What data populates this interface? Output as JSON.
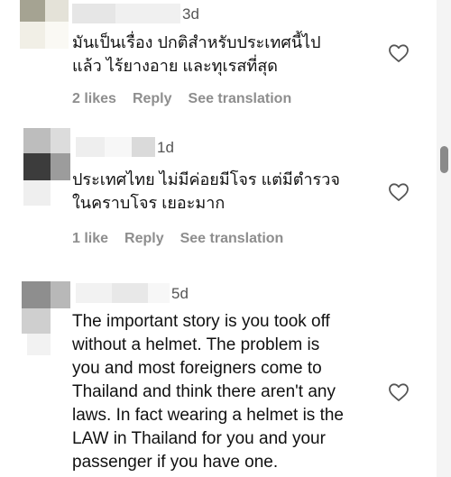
{
  "comments": [
    {
      "time": "3d",
      "text_lines": [
        "มันเป็นเรื่อง ปกติสำหรับประเทศนี้ไป",
        "แล้ว ไร้ยางอาย และทุเรสที่สุด"
      ],
      "likes": "2 likes",
      "reply": "Reply",
      "translate": "See translation"
    },
    {
      "time": "1d",
      "text_lines": [
        "ประเทศไทย ไม่มีค่อยมีโจร แต่มีตำรวจ",
        "ในคราบโจร เยอะมาก"
      ],
      "likes": "1 like",
      "reply": "Reply",
      "translate": "See translation"
    },
    {
      "time": "5d",
      "text_lines": [
        "The important story is you took off",
        "without a helmet. The problem is",
        "you and most foreigners come to",
        "Thailand and think there aren't any",
        "laws. In fact wearing a helmet is the",
        "LAW in Thailand for you and your",
        "passenger if you have one."
      ]
    }
  ],
  "icons": {
    "like": "heart-outline-icon"
  },
  "colors": {
    "meta_text": "#8e8e8e",
    "body_text": "#111111",
    "scroll_thumb": "#8a8a8a"
  }
}
